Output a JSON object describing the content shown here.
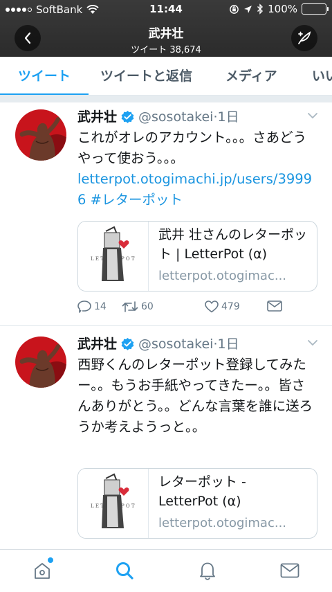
{
  "status_bar": {
    "carrier": "SoftBank",
    "time": "11:44",
    "battery": "100%",
    "battery_level": 1.0
  },
  "header": {
    "title": "武井壮",
    "subtitle": "ツイート 38,674",
    "back_icon": "chevron-left-icon",
    "compose_icon": "compose-feather-icon"
  },
  "tabs": [
    {
      "label": "ツイート",
      "active": true
    },
    {
      "label": "ツイートと返信",
      "active": false
    },
    {
      "label": "メディア",
      "active": false
    },
    {
      "label": "いい",
      "active": false
    }
  ],
  "tweets": [
    {
      "name": "武井壮",
      "handle": "@sosotakei",
      "dot": "·",
      "time": "1日",
      "text": "これがオレのアカウント。。。さあどうやって使おう。。。",
      "link": "letterpot.otogimachi.jp/users/39996",
      "hashtag": "#レターポット",
      "card": {
        "title": "武井 壮さんのレターポット | LetterPot (α)",
        "domain": "letterpot.otogimac..."
      },
      "counts": {
        "reply": "14",
        "retweet": "60",
        "like": "479"
      }
    },
    {
      "name": "武井壮",
      "handle": "@sosotakei",
      "dot": "·",
      "time": "1日",
      "text": "西野くんのレターポット登録してみたー。。もうお手紙やってきたー。。皆さんありがとう。。どんな言葉を誰に送ろうか考えようっと。。",
      "card": {
        "title": "レターポット - LetterPot (α)",
        "domain": "letterpot.otogimac..."
      }
    }
  ],
  "bottom_nav": [
    {
      "icon": "home-icon",
      "active": false,
      "notification_dot": true
    },
    {
      "icon": "search-icon",
      "active": true
    },
    {
      "icon": "bell-icon",
      "active": false
    },
    {
      "icon": "mail-icon",
      "active": false
    }
  ],
  "colors": {
    "accent": "#1da1f2",
    "link": "#1b95e0",
    "header_bg": "#2b2b2b",
    "verified": "#1da1f2",
    "battery": "#4cd964"
  }
}
